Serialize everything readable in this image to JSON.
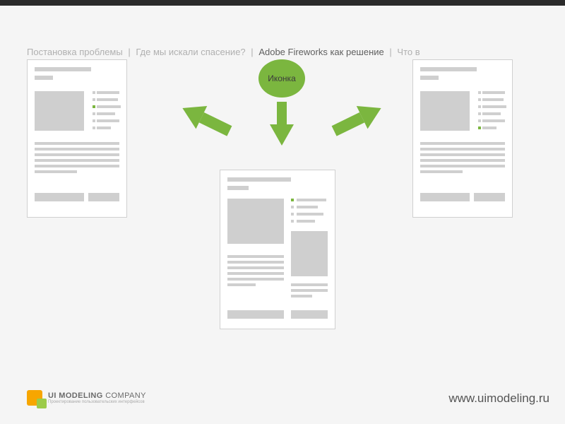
{
  "breadcrumb": {
    "items": [
      {
        "label": "Постановка проблемы",
        "active": false
      },
      {
        "label": "Где мы искали спасение?",
        "active": false
      },
      {
        "label": "Adobe Fireworks как решение",
        "active": true
      },
      {
        "label": "Что в",
        "active": false
      }
    ],
    "separator": "|"
  },
  "diagram": {
    "circle_label": "Иконка",
    "accent_color": "#7bb63f"
  },
  "footer": {
    "company_bold": "UI MODELING",
    "company_thin": "COMPANY",
    "tagline": "Проектирование пользовательских интерфейсов",
    "url": "www.uimodeling.ru"
  }
}
